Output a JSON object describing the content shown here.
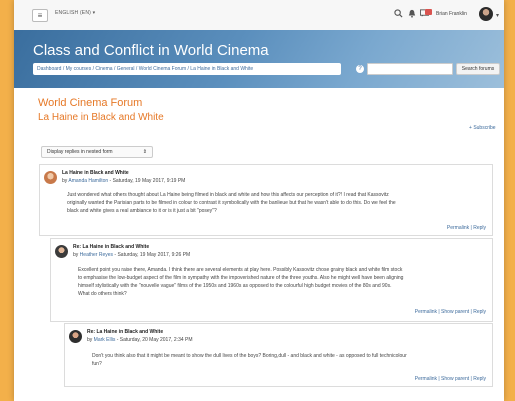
{
  "navbar": {
    "language": "ENGLISH (EN) ▾",
    "user_name": "Brian Franklin",
    "icons": [
      "menu-icon",
      "search-icon",
      "bell-icon",
      "messages-icon"
    ]
  },
  "header": {
    "title": "Class and Conflict in World Cinema",
    "breadcrumb": "Dashboard / My courses / Cinema / General / World Cinema Forum / La Haine in Black and White",
    "search_input_value": "",
    "search_button": "Search forums"
  },
  "main": {
    "forum_title": "World Cinema Forum",
    "discussion_title": "La Haine in Black and White",
    "subscribe_label": "Subscribe",
    "display_mode": "Display replies in nested form"
  },
  "posts": [
    {
      "subject": "La Haine in Black and White",
      "by_prefix": "by ",
      "author": "Amanda Hamilton",
      "date": " - Saturday, 19 May 2017, 9:19 PM",
      "body": [
        "Just wondered what others thought about La Haine being filmed in black and white and how this affects our perception of it?! I read that Kassovitz",
        "originally wanted the Parisian parts to be filmed in colour to contrast it symbolically  with the banlieue but that he wasn't able to do this. Do  we feel the",
        "black and white gives a real ambiance to it or is it just a bit \"posey\"?"
      ],
      "footer": "Permalink | Reply"
    },
    {
      "subject": "Re: La Haine in Black and White",
      "by_prefix": "by ",
      "author": "Heather Reyes",
      "date": " - Saturday, 19 May 2017, 9:26 PM",
      "body": [
        "Excellent point you raise there, Amanda. I think there are several elements at play here. Possibly Kassovitz chose grainy black and white film stock",
        "to emphasise the low-budget aspect of the film in sympathy with the impoverished nature of the three youths. Also he might well have been aligning",
        "himself stylistically with the \"nouvelle vague\" films of the 1950s and 1960s as opposed to the  colourful high budget movies of the 80s and 90s.",
        "What do others think?"
      ],
      "footer": "Permalink | Show parent | Reply"
    },
    {
      "subject": "Re: La Haine in Black and White",
      "by_prefix": "by ",
      "author": "Mark Ellis",
      "date": " - Saturday, 20 May 2017, 2:34 PM",
      "body": [
        "Don't you think also that it might be meant to show the dull lives of the boys?  Boring,dull - and black and white - as opposed to full technicolour",
        "fun?"
      ],
      "footer": "Permalink | Show parent | Reply"
    }
  ],
  "colors": {
    "page_background": "#f3b04a",
    "accent_orange": "#e67826",
    "link_blue": "#3d6b9c",
    "banner_blue": "#5b8fbd",
    "badge_red": "#d9534f"
  }
}
